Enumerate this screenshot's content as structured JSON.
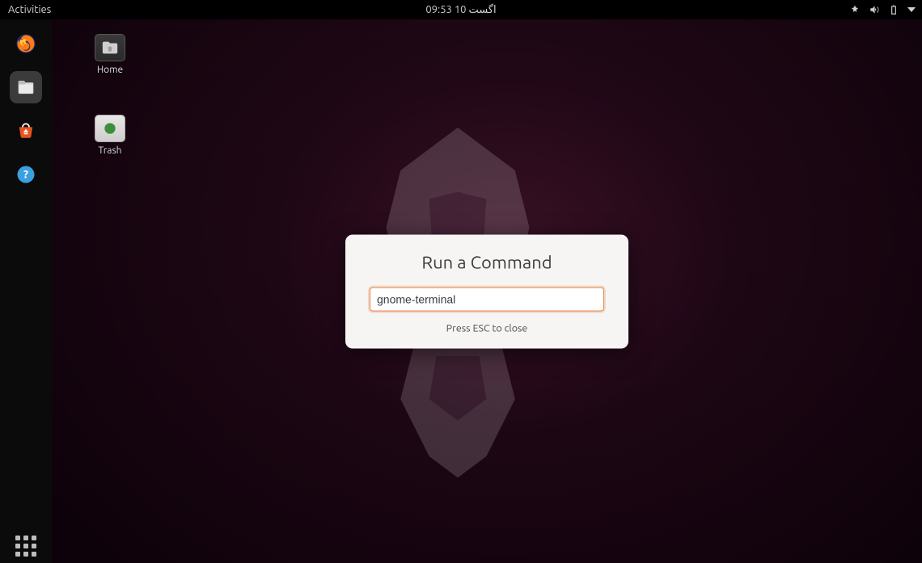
{
  "panel": {
    "activities": "Activities",
    "clock": "09:53  اگست 10"
  },
  "dock": {
    "firefox": "Firefox",
    "files": "Files",
    "software": "Ubuntu Software",
    "help": "Help",
    "apps": "Show Applications"
  },
  "desktop": {
    "home": "Home",
    "trash": "Trash"
  },
  "run_dialog": {
    "title": "Run a Command",
    "command_value": "gnome-terminal",
    "hint": "Press ESC to close"
  }
}
